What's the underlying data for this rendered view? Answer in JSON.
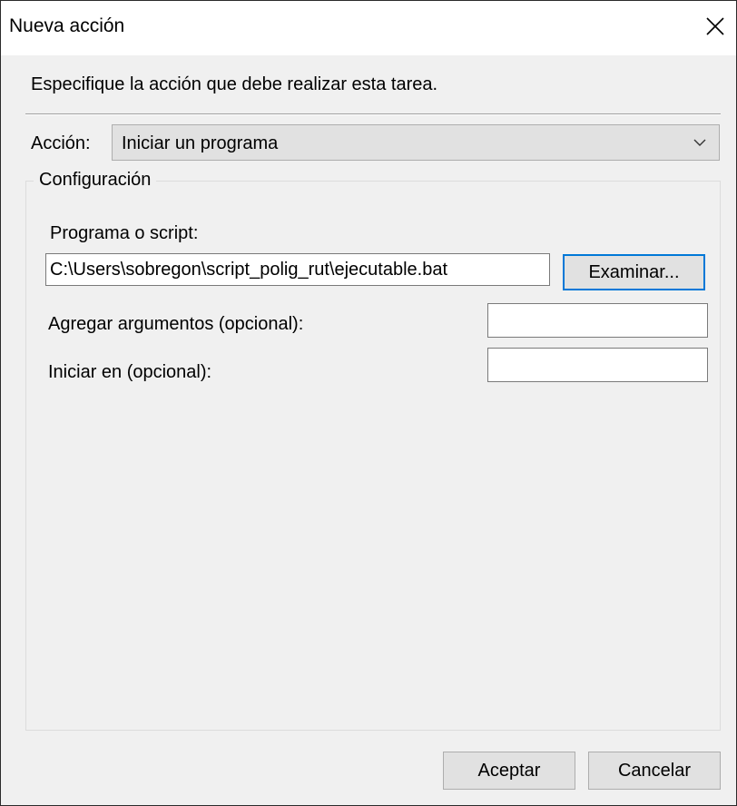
{
  "window": {
    "title": "Nueva acción",
    "close_icon": "close-icon"
  },
  "instruction": "Especifique la acción que debe realizar esta tarea.",
  "action": {
    "label": "Acción:",
    "selected": "Iniciar un programa",
    "dropdown_icon": "chevron-down-icon"
  },
  "settings": {
    "group_label": "Configuración",
    "program_label": "Programa o script:",
    "program_value": "C:\\Users\\sobregon\\script_polig_rut\\ejecutable.bat",
    "browse_label": "Examinar...",
    "arguments_label": "Agregar argumentos (opcional):",
    "arguments_value": "",
    "start_in_label": "Iniciar en (opcional):",
    "start_in_value": ""
  },
  "buttons": {
    "ok_label": "Aceptar",
    "cancel_label": "Cancelar"
  },
  "colors": {
    "focus_border": "#0078d7",
    "button_face": "#e1e1e1",
    "dialog_background": "#f0f0f0"
  }
}
